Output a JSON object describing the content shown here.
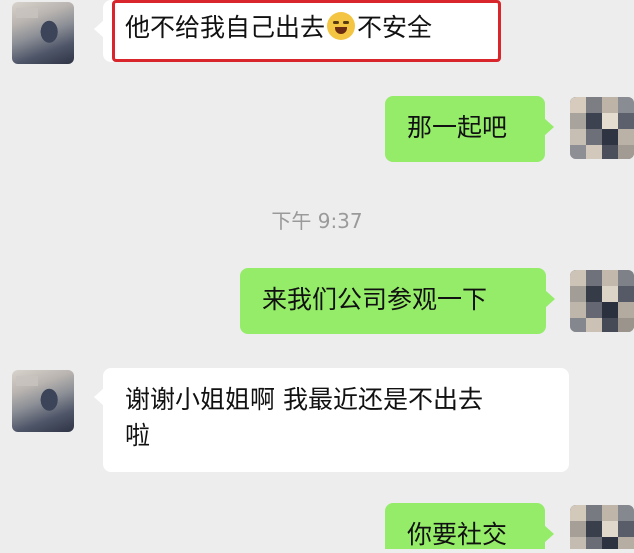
{
  "chat": {
    "messages": [
      {
        "side": "left",
        "text_before": "他不给我自己出去",
        "emoji": "crying-laughing-face",
        "text_after": "不安全"
      },
      {
        "side": "right",
        "text": "那一起吧"
      },
      {
        "side": "right",
        "text": "来我们公司参观一下"
      },
      {
        "side": "left",
        "line1": "谢谢小姐姐啊 我最近还是不出去",
        "line2": "啦"
      },
      {
        "side": "right",
        "text": "你要社交"
      }
    ],
    "timestamp": "下午 9:37"
  },
  "colors": {
    "background": "#ededed",
    "bubble_self": "#95ec69",
    "bubble_other": "#ffffff",
    "highlight_border": "#d9262c",
    "timestamp_text": "#9a9a9a"
  }
}
